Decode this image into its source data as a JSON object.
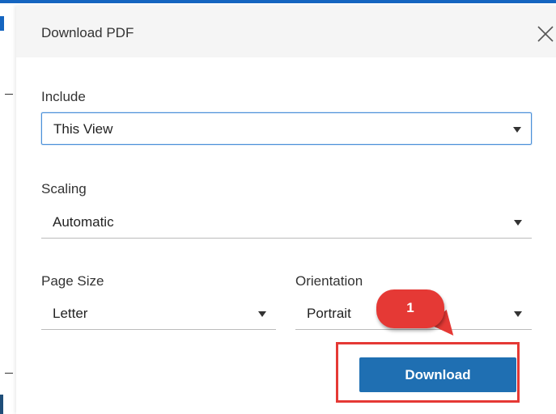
{
  "dialog": {
    "title": "Download PDF",
    "close_icon": "close-icon"
  },
  "include": {
    "label": "Include",
    "value": "This View"
  },
  "scaling": {
    "label": "Scaling",
    "value": "Automatic"
  },
  "page_size": {
    "label": "Page Size",
    "value": "Letter"
  },
  "orientation": {
    "label": "Orientation",
    "value": "Portrait"
  },
  "download": {
    "label": "Download"
  },
  "annotation": {
    "step_number": "1"
  },
  "colors": {
    "header_bg": "#f5f5f5",
    "focus_border": "#4a90d9",
    "button_bg": "#1f6fb2",
    "highlight_red": "#e53935",
    "accent_blue": "#1565c0"
  }
}
